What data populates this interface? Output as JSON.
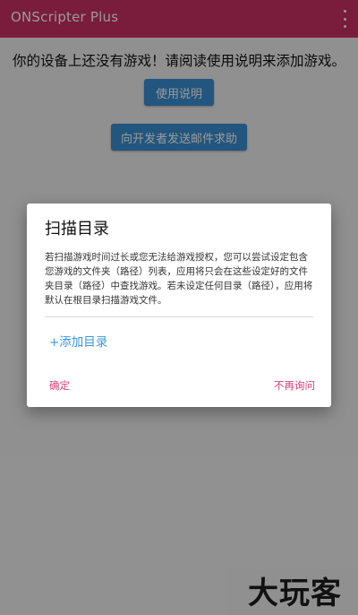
{
  "appbar": {
    "title": "ONScripter Plus",
    "color": "#cc2f63",
    "menu_icon": "overflow-menu-icon"
  },
  "main": {
    "empty_message": "你的设备上还没有游戏！请阅读使用说明来添加游戏。",
    "manual_button": "使用说明",
    "email_button": "向开发者发送邮件求助"
  },
  "dialog": {
    "title": "扫描目录",
    "body": "若扫描游戏时间过长或您无法给游戏授权，您可以尝试设定包含您游戏的文件夹（路径）列表，应用将只会在这些设定好的文件夹目录（路径）中查找游戏。若未设定任何目录（路径），应用将默认在根目录扫描游戏文件。",
    "add_directory": "+添加目录",
    "ok_button": "确定",
    "never_ask_button": "不再询问",
    "accent_color": "#d9407a",
    "link_color": "#3a98d8"
  },
  "watermark": {
    "text": "大玩客"
  }
}
